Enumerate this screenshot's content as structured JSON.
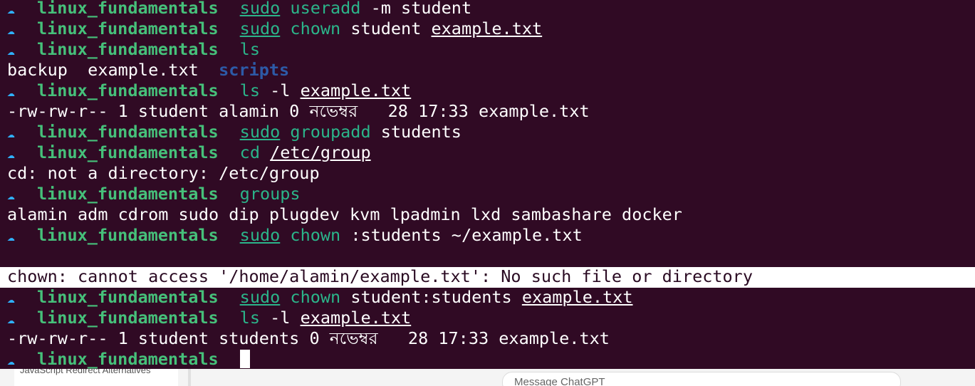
{
  "prompt": {
    "icon": "cloud-icon",
    "directory": "linux_fundamentals"
  },
  "lines": [
    {
      "type": "cmd",
      "sudo": "sudo",
      "cmd": "useradd",
      "args": " -m student",
      "uarg": ""
    },
    {
      "type": "cmd",
      "sudo": "sudo",
      "cmd": "chown",
      "args": " student ",
      "uarg": "example.txt"
    },
    {
      "type": "cmd",
      "sudo": "",
      "cmd": "ls",
      "args": "",
      "uarg": ""
    },
    {
      "type": "out-ls",
      "files": "backup  example.txt  ",
      "folder": "scripts"
    },
    {
      "type": "cmd",
      "sudo": "",
      "cmd": "ls",
      "args": " -l ",
      "uarg": "example.txt"
    },
    {
      "type": "out",
      "text": "-rw-rw-r-- 1 student alamin 0 নভেম্বর   28 17:33 example.txt"
    },
    {
      "type": "cmd",
      "sudo": "sudo",
      "cmd": "groupadd",
      "args": " students",
      "uarg": ""
    },
    {
      "type": "cmd",
      "sudo": "",
      "cmd": "cd",
      "args": " ",
      "uarg": "/etc/group"
    },
    {
      "type": "out",
      "text": "cd: not a directory: /etc/group"
    },
    {
      "type": "cmd",
      "sudo": "",
      "cmd": "groups",
      "args": "",
      "uarg": ""
    },
    {
      "type": "out",
      "text": "alamin adm cdrom sudo dip plugdev kvm lpadmin lxd sambashare docker"
    },
    {
      "type": "cmd",
      "sudo": "sudo",
      "cmd": "chown",
      "args": " :students ~/example.txt",
      "uarg": ""
    },
    {
      "type": "blank"
    },
    {
      "type": "out-hl",
      "text": "chown: cannot access '/home/alamin/example.txt': No such file or directory"
    },
    {
      "type": "cmd",
      "sudo": "sudo",
      "cmd": "chown",
      "args": " student:students ",
      "uarg": "example.txt"
    },
    {
      "type": "cmd",
      "sudo": "",
      "cmd": "ls",
      "args": " -l ",
      "uarg": "example.txt"
    },
    {
      "type": "out",
      "text": "-rw-rw-r-- 1 student students 0 নভেম্বর   28 17:33 example.txt"
    },
    {
      "type": "prompt-cursor"
    }
  ],
  "background": {
    "tab_text": "JavaScript Redirect Alternatives",
    "chat_placeholder": "Message ChatGPT"
  }
}
